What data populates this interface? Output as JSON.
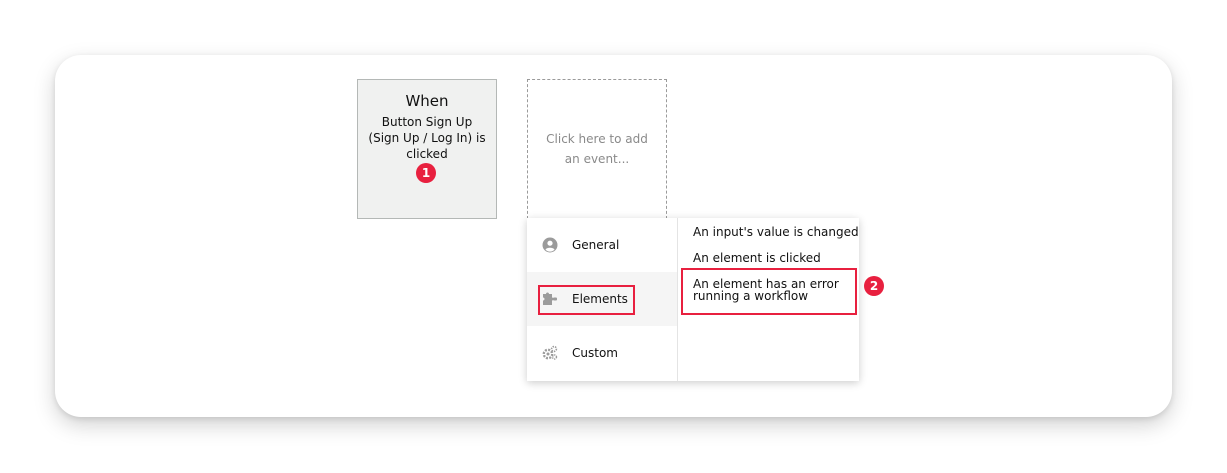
{
  "trigger": {
    "title": "When",
    "description": "Button Sign Up (Sign Up / Log In) is clicked",
    "badge": "1"
  },
  "add_event": {
    "placeholder": "Click here to add an event..."
  },
  "menu": {
    "categories": [
      {
        "label": "General",
        "icon": "user-circle-icon"
      },
      {
        "label": "Elements",
        "icon": "puzzle-icon"
      },
      {
        "label": "Custom",
        "icon": "gears-icon"
      }
    ],
    "events": [
      {
        "label": "An input's value is changed"
      },
      {
        "label": "An element is clicked"
      },
      {
        "label": "An element has an error running a workflow"
      }
    ],
    "badge": "2"
  },
  "colors": {
    "highlight": "#e8203f",
    "box_background": "#f0f1f0",
    "active_row": "#f5f5f5"
  }
}
